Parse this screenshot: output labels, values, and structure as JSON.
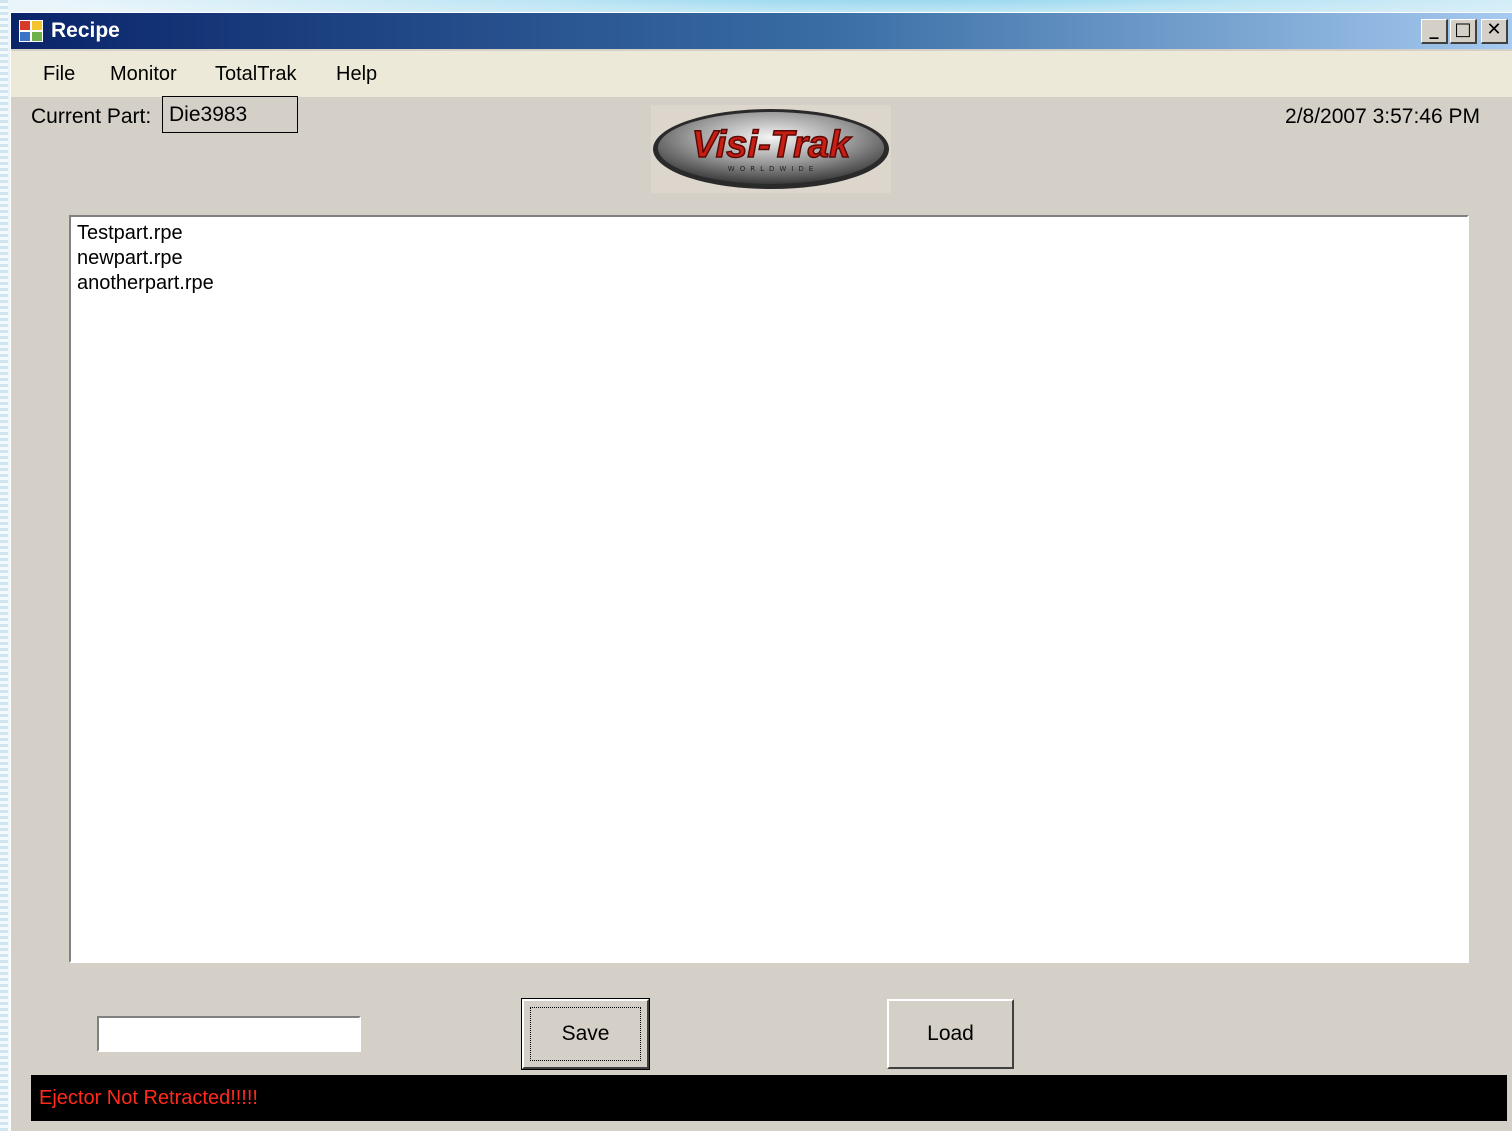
{
  "window": {
    "title": "Recipe",
    "controls": {
      "minimize": "_",
      "maximize": "□",
      "close": "✕"
    }
  },
  "menu": [
    "File",
    "Monitor",
    "TotalTrak",
    "Help"
  ],
  "header": {
    "current_part_label": "Current Part:",
    "current_part_value": "Die3983",
    "datetime": "2/8/2007 3:57:46 PM",
    "logo_text": "Visi-Trak",
    "logo_subtext": "WORLDWIDE"
  },
  "recipe_list": [
    "Testpart.rpe",
    "newpart.rpe",
    "anotherpart.rpe"
  ],
  "form": {
    "filename_value": "",
    "save_label": "Save",
    "load_label": "Load"
  },
  "status": {
    "message": "Ejector Not Retracted!!!!!",
    "message_color": "#ff2a1a",
    "bar_color": "#000000"
  },
  "icons": {
    "app": "app-icon",
    "minimize": "minimize-icon",
    "maximize": "maximize-icon",
    "close": "close-icon"
  }
}
